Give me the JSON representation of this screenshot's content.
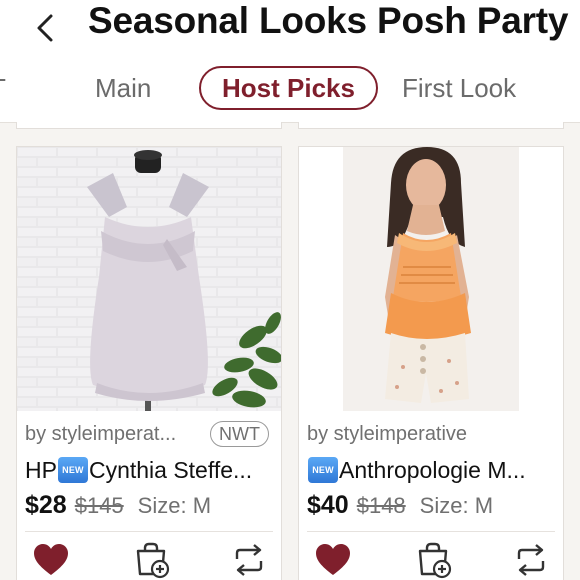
{
  "header": {
    "title": "Seasonal Looks Posh Party"
  },
  "tabs": [
    {
      "label": "T"
    },
    {
      "label": "Main"
    },
    {
      "label": "Host Picks",
      "active": true
    },
    {
      "label": "First Look"
    }
  ],
  "listings": [
    {
      "seller": "by styleimperat...",
      "badge": "NWT",
      "new_tag": "NEW",
      "name_prefix": "HP",
      "name": "Cynthia Steffe...",
      "price": "$28",
      "original_price": "$145",
      "size": "Size: M",
      "liked": true
    },
    {
      "seller": "by styleimperative",
      "new_tag": "NEW",
      "name": "Anthropologie M...",
      "price": "$40",
      "original_price": "$148",
      "size": "Size: M",
      "liked": true
    }
  ],
  "icons": {
    "back": "chevron-left-icon",
    "like": "heart-icon",
    "bundle": "bundle-add-icon",
    "share": "share-repost-icon"
  },
  "colors": {
    "brand": "#7f1f2c",
    "background": "#f6f4f1"
  }
}
